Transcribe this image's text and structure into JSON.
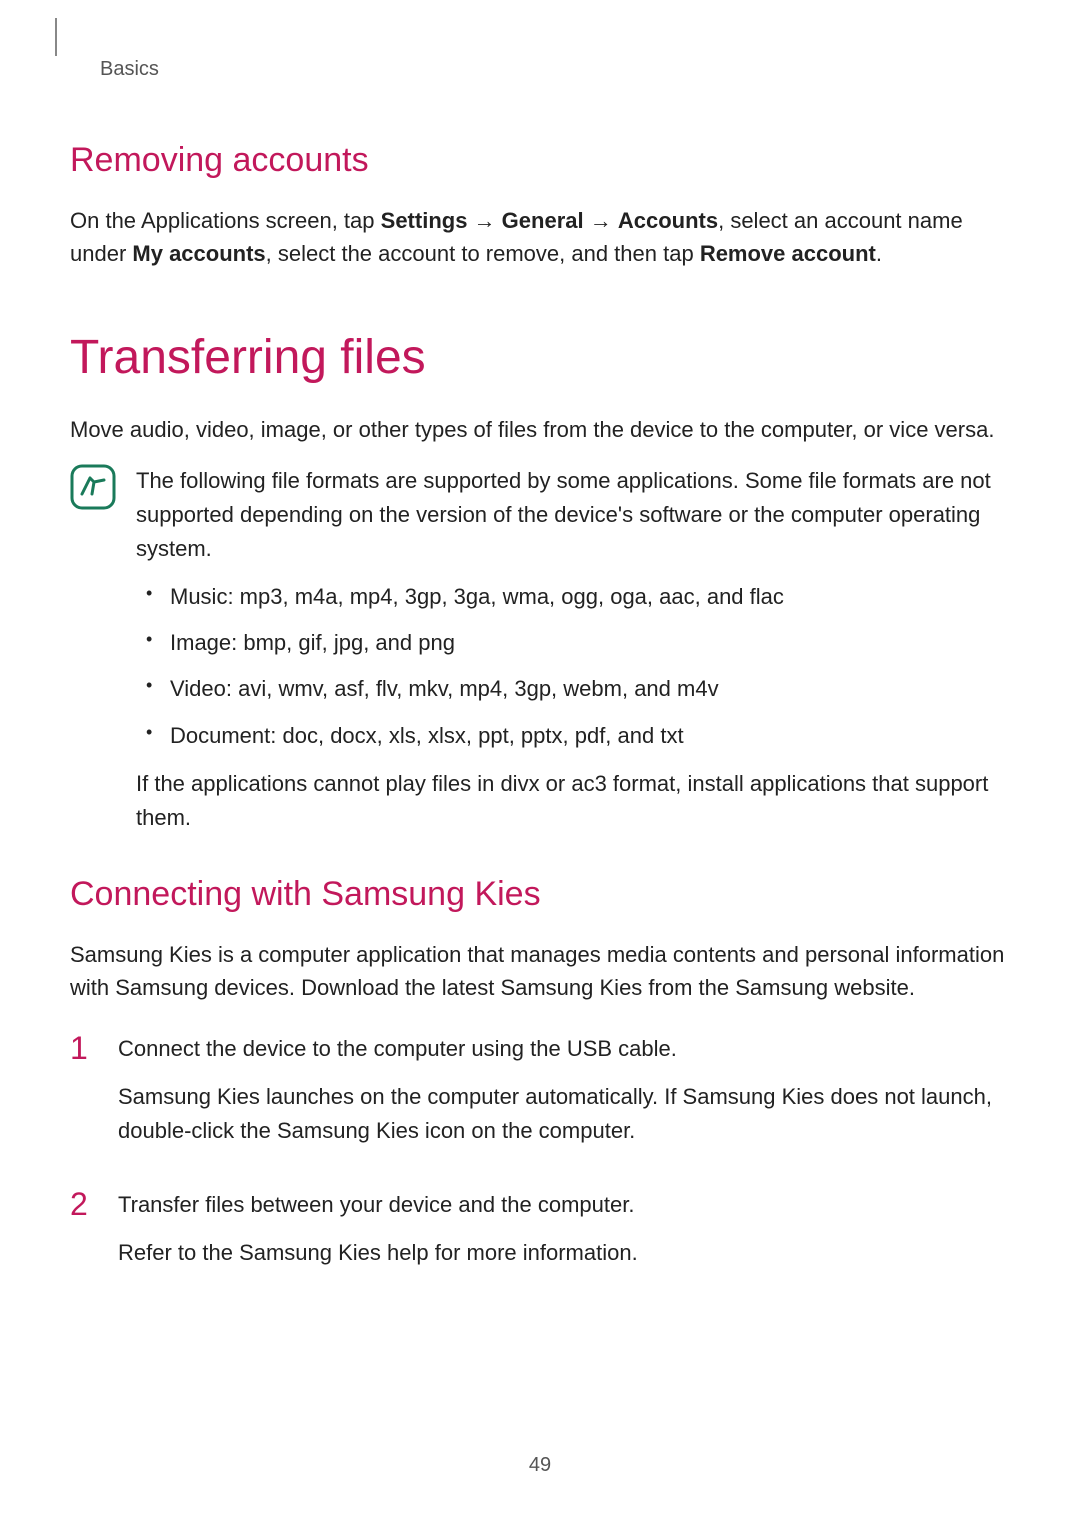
{
  "breadcrumb": "Basics",
  "removing": {
    "heading": "Removing accounts",
    "p_pre": "On the Applications screen, tap ",
    "settings": "Settings",
    "arrow1": " → ",
    "general": "General",
    "arrow2": " → ",
    "accounts": "Accounts",
    "p_mid": ", select an account name under ",
    "my_accounts": "My accounts",
    "p_mid2": ", select the account to remove, and then tap ",
    "remove_account": "Remove account",
    "p_end": "."
  },
  "transferring": {
    "heading": "Transferring files",
    "intro": "Move audio, video, image, or other types of files from the device to the computer, or vice versa."
  },
  "note": {
    "lead": "The following file formats are supported by some applications. Some file formats are not supported depending on the version of the device's software or the computer operating system.",
    "bullets": [
      "Music: mp3, m4a, mp4, 3gp, 3ga, wma, ogg, oga, aac, and flac",
      "Image: bmp, gif, jpg, and png",
      "Video: avi, wmv, asf, flv, mkv, mp4, 3gp, webm, and m4v",
      "Document: doc, docx, xls, xlsx, ppt, pptx, pdf, and txt"
    ],
    "trail": "If the applications cannot play files in divx or ac3 format, install applications that support them."
  },
  "kies": {
    "heading": "Connecting with Samsung Kies",
    "intro": "Samsung Kies is a computer application that manages media contents and personal information with Samsung devices. Download the latest Samsung Kies from the Samsung website.",
    "steps": [
      {
        "num": "1",
        "line1": "Connect the device to the computer using the USB cable.",
        "line2": "Samsung Kies launches on the computer automatically. If Samsung Kies does not launch, double-click the Samsung Kies icon on the computer."
      },
      {
        "num": "2",
        "line1": "Transfer files between your device and the computer.",
        "line2": "Refer to the Samsung Kies help for more information."
      }
    ]
  },
  "page_number": "49"
}
